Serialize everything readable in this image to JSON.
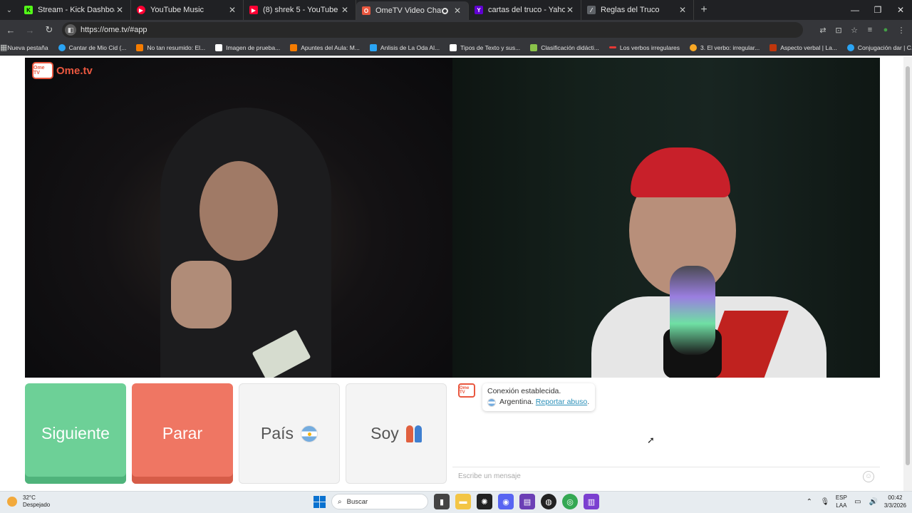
{
  "browser": {
    "tab_menu_icon": "chevron-down-icon",
    "tabs": [
      {
        "title": "Stream - Kick Dashboard",
        "favicon_color": "#53fc18",
        "favicon_letter": "K",
        "active": false
      },
      {
        "title": "YouTube Music",
        "favicon_color": "#ff0033",
        "favicon_letter": "▶",
        "active": false
      },
      {
        "title": "(8) shrek 5 - YouTube",
        "favicon_color": "#ff0033",
        "favicon_letter": "▶",
        "active": false
      },
      {
        "title": "OmeTV Video Chat — Ome",
        "favicon_color": "#e9573f",
        "favicon_letter": "O",
        "active": true
      },
      {
        "title": "cartas del truco - Yahoo Search",
        "favicon_color": "#6001d2",
        "favicon_letter": "Y",
        "active": false
      },
      {
        "title": "Reglas del Truco",
        "favicon_color": "#5f6368",
        "favicon_letter": "⁄",
        "active": false
      }
    ],
    "url": "https://ome.tv/#app",
    "bookmarks": [
      {
        "label": "Nueva pestaña",
        "color": "#35363a"
      },
      {
        "label": "Cantar de Mio Cid (...",
        "color": "#2aa4f4"
      },
      {
        "label": "No tan resumido: El...",
        "color": "#f57c00"
      },
      {
        "label": "Imagen de prueba...",
        "color": "#ffffff"
      },
      {
        "label": "Apuntes del Aula: M...",
        "color": "#f57c00"
      },
      {
        "label": "Anlisis de La Oda Al...",
        "color": "#2aa4f4"
      },
      {
        "label": "Tipos de Texto y sus...",
        "color": "#ffffff"
      },
      {
        "label": "Clasificación didácti...",
        "color": "#8bc34a"
      },
      {
        "label": "Los verbos irregulares",
        "color": "#e53935"
      },
      {
        "label": "3. El verbo: irregular...",
        "color": "#f9a825"
      },
      {
        "label": "Aspecto verbal | La...",
        "color": "#bf360c"
      },
      {
        "label": "Conjugación dar | C...",
        "color": "#2aa4f4"
      }
    ]
  },
  "app": {
    "logo_tv": "Ome TV",
    "logo_text": "Ome.tv",
    "buttons": {
      "next": "Siguiente",
      "stop": "Parar",
      "country": "País",
      "gender": "Soy"
    },
    "chat": {
      "status": "Conexión establecida.",
      "country": "Argentina.",
      "report": "Reportar abuso",
      "report_suffix": ".",
      "input_placeholder": "Escribe un mensaje"
    },
    "colors": {
      "next": "#6dd097",
      "stop": "#ef7663",
      "brand": "#e9573f"
    }
  },
  "taskbar": {
    "weather_temp": "32°C",
    "weather_desc": "Despejado",
    "search_placeholder": "Buscar",
    "lang_top": "ESP",
    "lang_bottom": "LAA",
    "time": "00:42",
    "date": "3/3/2026"
  }
}
